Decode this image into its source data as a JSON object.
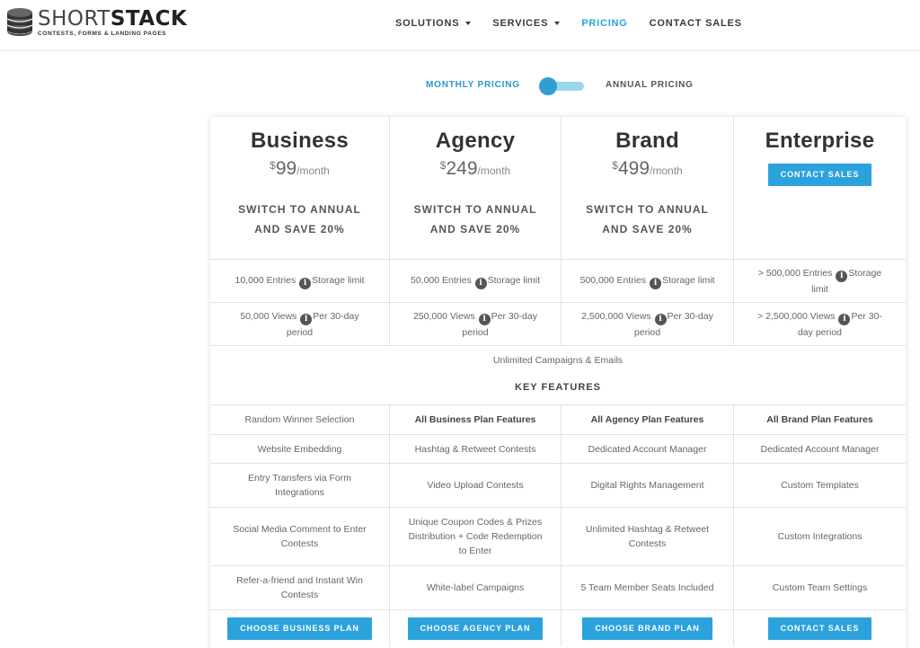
{
  "brand": {
    "name_light": "SHORT",
    "name_bold": "STACK",
    "tagline": "CONTESTS, FORMS & LANDING PAGES"
  },
  "nav": {
    "solutions": "SOLUTIONS",
    "services": "SERVICES",
    "pricing": "PRICING",
    "contact": "CONTACT SALES"
  },
  "billing": {
    "monthly": "MONTHLY PRICING",
    "annual": "ANNUAL PRICING",
    "selected": "monthly"
  },
  "plans": [
    {
      "name": "Business",
      "currency": "$",
      "amount": "99",
      "period": "/month",
      "switch_line1": "SWITCH TO ANNUAL",
      "switch_line2": "AND SAVE 20%",
      "entries": "10,000 Entries",
      "entries_suffix": "Storage limit",
      "views": "50,000 Views",
      "views_suffix": "Per 30-day period",
      "button": "CHOOSE BUSINESS PLAN"
    },
    {
      "name": "Agency",
      "currency": "$",
      "amount": "249",
      "period": "/month",
      "switch_line1": "SWITCH TO ANNUAL",
      "switch_line2": "AND SAVE 20%",
      "entries": "50,000 Entries",
      "entries_suffix": "Storage limit",
      "views": "250,000 Views",
      "views_suffix": "Per 30-day period",
      "button": "CHOOSE AGENCY PLAN"
    },
    {
      "name": "Brand",
      "currency": "$",
      "amount": "499",
      "period": "/month",
      "switch_line1": "SWITCH TO ANNUAL",
      "switch_line2": "AND SAVE 20%",
      "entries": "500,000 Entries",
      "entries_suffix": "Storage limit",
      "views": "2,500,000 Views",
      "views_suffix": "Per 30-day period",
      "button": "CHOOSE BRAND PLAN"
    },
    {
      "name": "Enterprise",
      "contact_button": "CONTACT SALES",
      "entries": "> 500,000 Entries",
      "entries_suffix": "Storage limit",
      "views": "> 2,500,000 Views",
      "views_suffix": "Per 30-day period",
      "button": "CONTACT SALES"
    }
  ],
  "shared": {
    "unlimited": "Unlimited Campaigns & Emails",
    "key_features": "KEY FEATURES"
  },
  "features": [
    [
      "Random Winner Selection",
      "All Business Plan Features",
      "All Agency Plan Features",
      "All Brand Plan Features"
    ],
    [
      "Website Embedding",
      "Hashtag & Retweet Contests",
      "Dedicated Account Manager",
      "Dedicated Account Manager"
    ],
    [
      "Entry Transfers via Form Integrations",
      "Video Upload Contests",
      "Digital Rights Management",
      "Custom Templates"
    ],
    [
      "Social Media Comment to Enter Contests",
      "Unique Coupon Codes & Prizes Distribution + Code Redemption to Enter",
      "Unlimited Hashtag & Retweet Contests",
      "Custom Integrations"
    ],
    [
      "Refer-a-friend and Instant Win Contests",
      "White-label Campaigns",
      "5 Team Member Seats Included",
      "Custom Team Settings"
    ]
  ],
  "colors": {
    "accent": "#2ca2dc",
    "toggle_track": "#9ad7ef",
    "text": "#444444"
  }
}
